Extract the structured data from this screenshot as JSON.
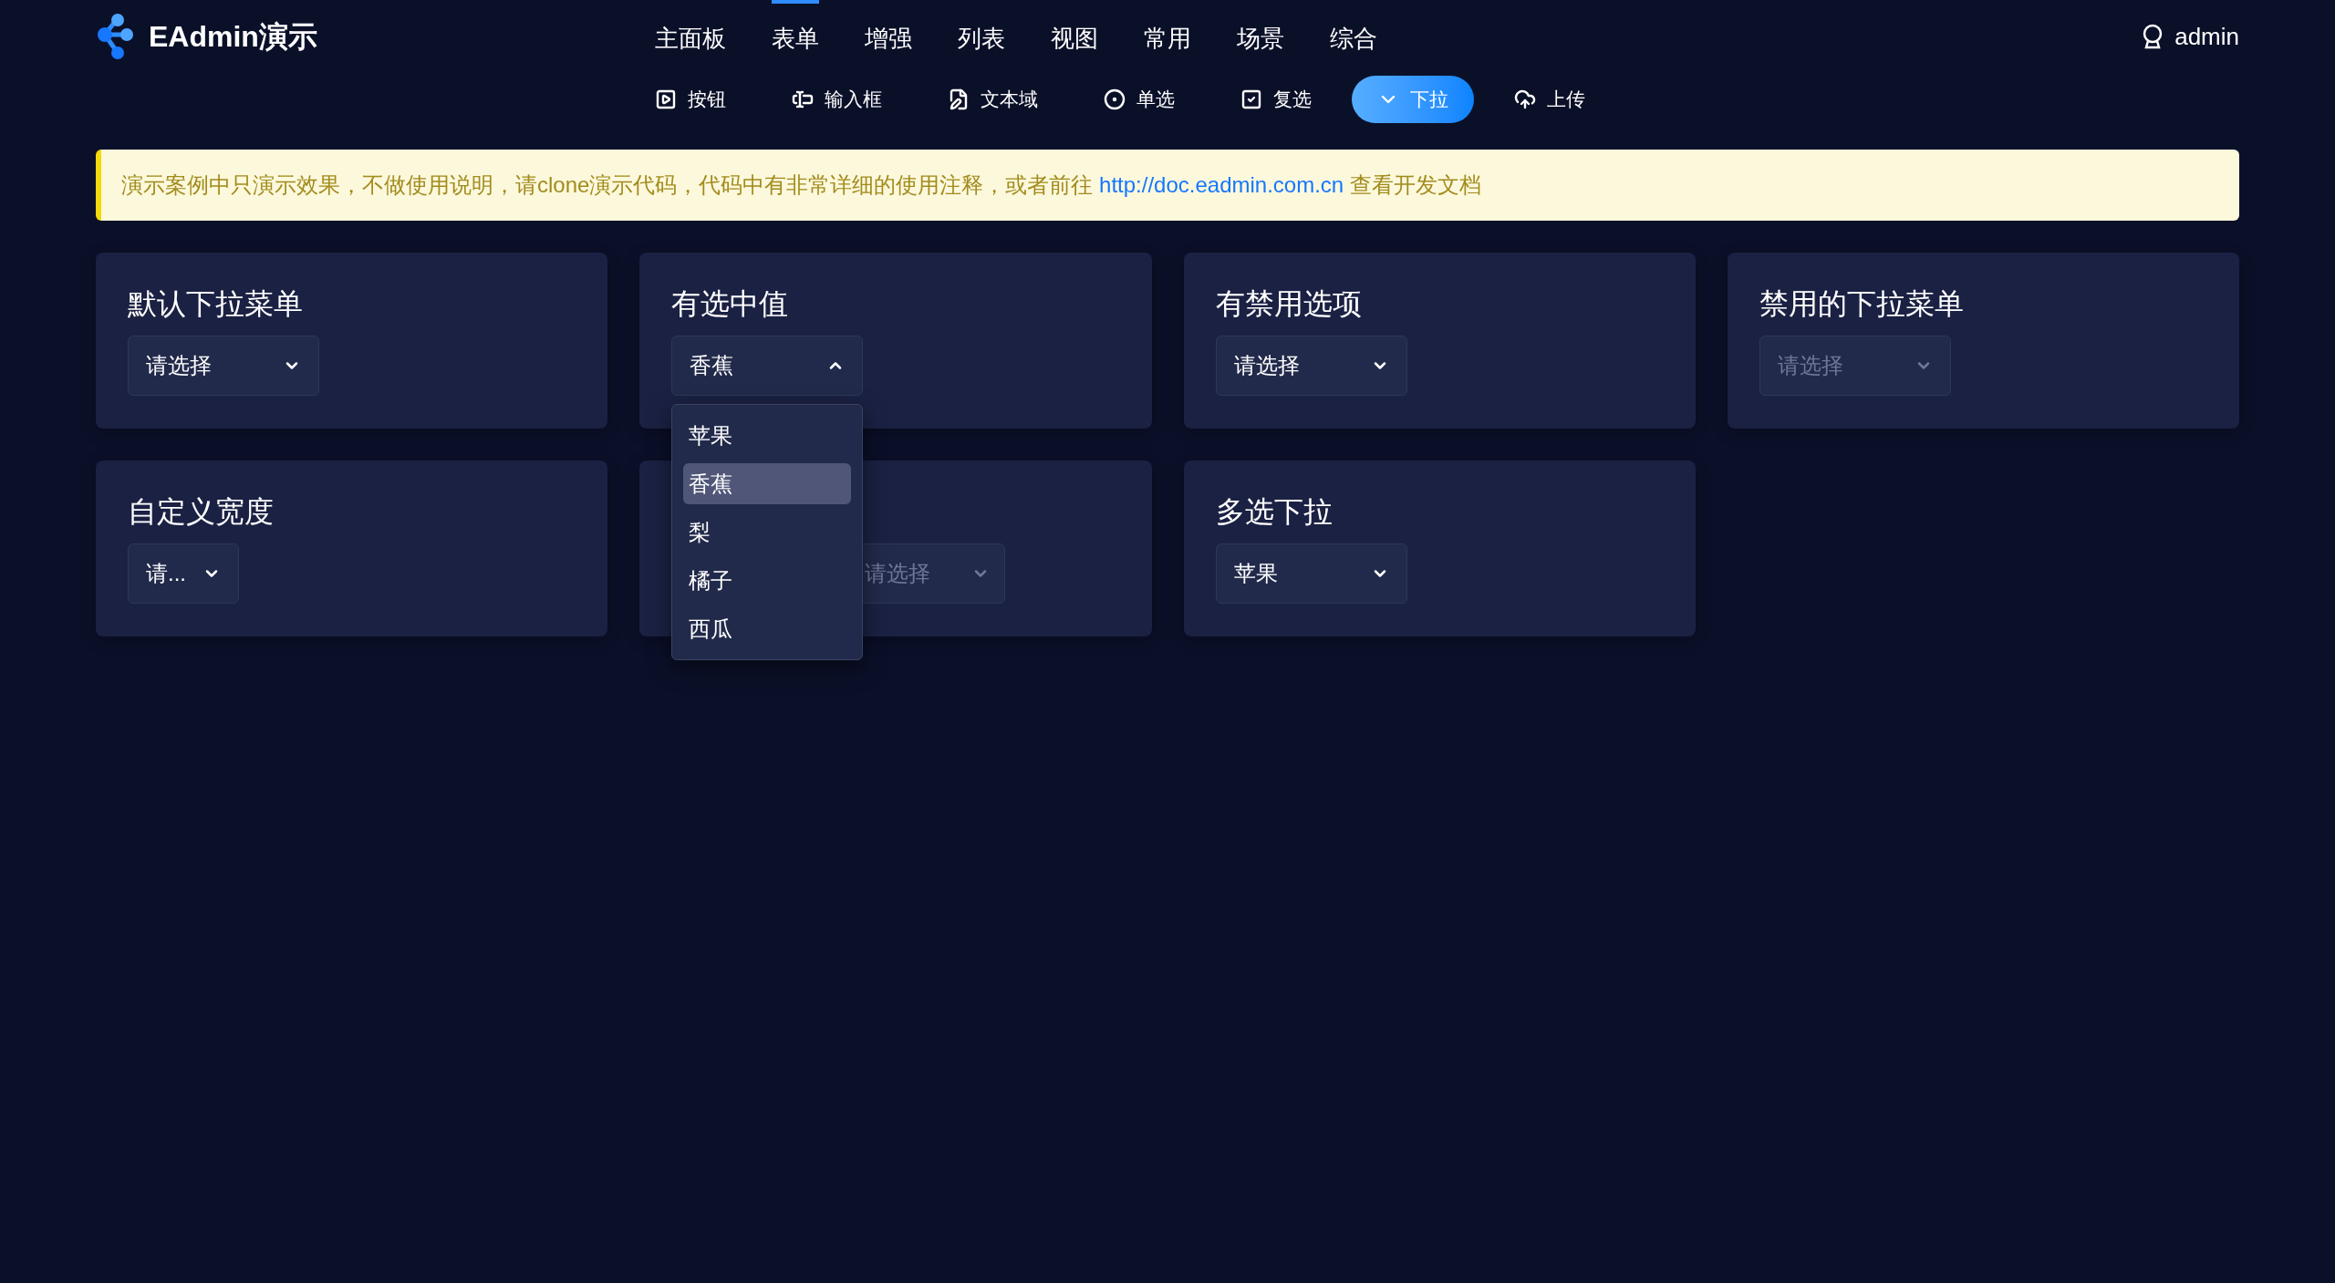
{
  "brand": "EAdmin演示",
  "nav": [
    {
      "label": "主面板",
      "selected": false
    },
    {
      "label": "表单",
      "selected": true
    },
    {
      "label": "增强",
      "selected": false
    },
    {
      "label": "列表",
      "selected": false
    },
    {
      "label": "视图",
      "selected": false
    },
    {
      "label": "常用",
      "selected": false
    },
    {
      "label": "场景",
      "selected": false
    },
    {
      "label": "综合",
      "selected": false
    }
  ],
  "user": "admin",
  "subnav": [
    {
      "label": "按钮",
      "selected": false
    },
    {
      "label": "输入框",
      "selected": false
    },
    {
      "label": "文本域",
      "selected": false
    },
    {
      "label": "单选",
      "selected": false
    },
    {
      "label": "复选",
      "selected": false
    },
    {
      "label": "下拉",
      "selected": true
    },
    {
      "label": "上传",
      "selected": false
    }
  ],
  "notice": {
    "text": "演示案例中只演示效果，不做使用说明，请clone演示代码，代码中有非常详细的使用注释，或者前往",
    "link": "http://doc.eadmin.com.cn",
    "after": "查看开发文档"
  },
  "cards": [
    {
      "title": "默认下拉菜单",
      "select": {
        "kind": "normal",
        "value": "请选择",
        "disabled": false,
        "expanded": false
      }
    },
    {
      "title": "有选中值",
      "select": {
        "kind": "normal",
        "value": "香蕉",
        "disabled": false,
        "expanded": true,
        "options": [
          {
            "label": "苹果",
            "selected": false
          },
          {
            "label": "香蕉",
            "selected": true
          },
          {
            "label": "梨",
            "selected": false
          },
          {
            "label": "橘子",
            "selected": false
          },
          {
            "label": "西瓜",
            "selected": false
          }
        ]
      }
    },
    {
      "title": "有禁用选项",
      "select": {
        "kind": "normal",
        "value": "请选择",
        "disabled": false,
        "expanded": false
      }
    },
    {
      "title": "禁用的下拉菜单",
      "select": {
        "kind": "normal",
        "value": "请选择",
        "disabled": true,
        "expanded": false
      }
    },
    {
      "title": "自定义宽度",
      "select": {
        "kind": "narrow",
        "value": "请...",
        "disabled": false,
        "expanded": false
      }
    },
    {
      "select": {
        "kind": "wide",
        "placeholder": "请选择",
        "expanded": false
      }
    },
    {
      "title": "多选下拉",
      "select": {
        "kind": "normal",
        "value": "苹果",
        "disabled": false,
        "expanded": false
      }
    }
  ]
}
